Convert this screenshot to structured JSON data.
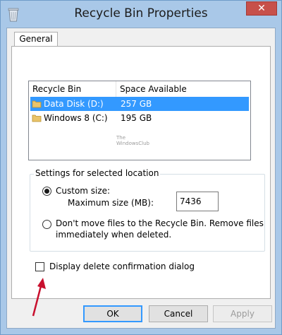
{
  "window": {
    "title": "Recycle Bin Properties",
    "close_label": "✕"
  },
  "tabs": [
    {
      "label": "General"
    }
  ],
  "listview": {
    "columns": [
      "Recycle Bin Location",
      "Space Available"
    ],
    "rows": [
      {
        "name": "Data Disk (D:)",
        "space": "257 GB",
        "selected": true
      },
      {
        "name": "Windows 8 (C:)",
        "space": "195 GB",
        "selected": false
      }
    ],
    "watermark": [
      "The",
      "WindowsClub"
    ]
  },
  "settings": {
    "group_label": "Settings for selected location",
    "custom_size_label": "Custom size:",
    "custom_size_selected": true,
    "max_size_label": "Maximum size (MB):",
    "max_size_value": "7436",
    "dont_move_label_line1": "Don't move files to the Recycle Bin. Remove files",
    "dont_move_label_line2": "immediately when deleted.",
    "dont_move_selected": false
  },
  "confirmation": {
    "label": "Display delete confirmation dialog",
    "checked": false
  },
  "buttons": {
    "ok": "OK",
    "cancel": "Cancel",
    "apply": "Apply"
  },
  "colors": {
    "selection": "#3399ff",
    "annotation_arrow": "#c8102e",
    "title_bar": "#a9c8e8",
    "close_button": "#c7504a"
  }
}
